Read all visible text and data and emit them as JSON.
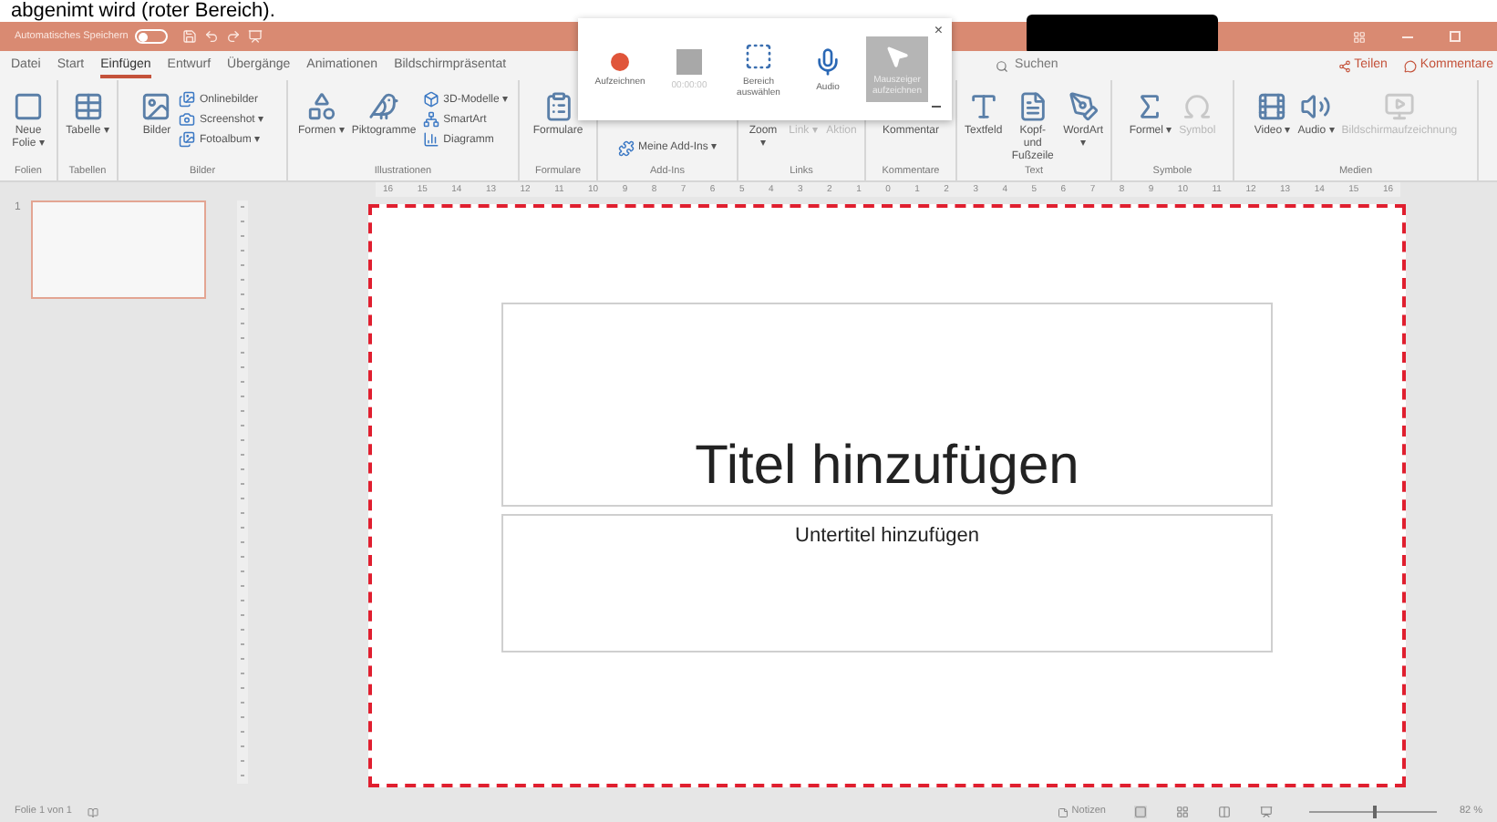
{
  "caption": "abgenimt wird (roter Bereich).",
  "title_bar": {
    "autosave_label": "Automatisches Speichern",
    "autosave_on": false
  },
  "tabs": [
    {
      "label": "Datei",
      "selected": false
    },
    {
      "label": "Start",
      "selected": false
    },
    {
      "label": "Einfügen",
      "selected": true
    },
    {
      "label": "Entwurf",
      "selected": false
    },
    {
      "label": "Übergänge",
      "selected": false
    },
    {
      "label": "Animationen",
      "selected": false
    },
    {
      "label": "Bildschirmpräsentat",
      "selected": false
    }
  ],
  "search": {
    "placeholder": "Suchen"
  },
  "share_button": "Teilen",
  "comments_button": "Kommentare",
  "ribbon_groups": [
    {
      "label": "Folien",
      "items": [
        {
          "kind": "large",
          "label": "Neue Folie ▾",
          "disabled": false
        }
      ]
    },
    {
      "label": "Tabellen",
      "items": [
        {
          "kind": "large",
          "label": "Tabelle ▾",
          "disabled": false
        }
      ]
    },
    {
      "label": "Bilder",
      "items": [
        {
          "kind": "large",
          "label": "Bilder",
          "disabled": false
        },
        {
          "kind": "small",
          "label": "Onlinebilder",
          "disabled": false
        },
        {
          "kind": "small",
          "label": "Screenshot ▾",
          "disabled": false
        },
        {
          "kind": "small",
          "label": "Fotoalbum ▾",
          "disabled": false
        }
      ]
    },
    {
      "label": "Illustrationen",
      "items": [
        {
          "kind": "large",
          "label": "Formen ▾",
          "disabled": false
        },
        {
          "kind": "large",
          "label": "Piktogramme",
          "disabled": false
        },
        {
          "kind": "small",
          "label": "3D-Modelle ▾",
          "disabled": false
        },
        {
          "kind": "small",
          "label": "SmartArt",
          "disabled": false
        },
        {
          "kind": "small",
          "label": "Diagramm",
          "disabled": false
        }
      ]
    },
    {
      "label": "Formulare",
      "items": [
        {
          "kind": "large",
          "label": "Formulare",
          "disabled": false
        }
      ]
    },
    {
      "label": "Add-Ins",
      "items": [
        {
          "kind": "small",
          "label": "Meine Add-Ins ▾",
          "disabled": false
        }
      ]
    },
    {
      "label": "Links",
      "items": [
        {
          "kind": "large",
          "label": "Zoom ▾",
          "disabled": false
        },
        {
          "kind": "large",
          "label": "Link ▾",
          "disabled": true
        },
        {
          "kind": "large",
          "label": "Aktion",
          "disabled": true
        }
      ]
    },
    {
      "label": "Kommentare",
      "items": [
        {
          "kind": "large",
          "label": "Kommentar",
          "disabled": false
        }
      ]
    },
    {
      "label": "Text",
      "items": [
        {
          "kind": "large",
          "label": "Textfeld",
          "disabled": false
        },
        {
          "kind": "large",
          "label": "Kopf- und Fußzeile",
          "disabled": false
        },
        {
          "kind": "large",
          "label": "WordArt ▾",
          "disabled": false
        }
      ]
    },
    {
      "label": "Symbole",
      "items": [
        {
          "kind": "large",
          "label": "Formel ▾",
          "disabled": false
        },
        {
          "kind": "large",
          "label": "Symbol",
          "disabled": true
        }
      ]
    },
    {
      "label": "Medien",
      "items": [
        {
          "kind": "large",
          "label": "Video ▾",
          "disabled": false
        },
        {
          "kind": "large",
          "label": "Audio ▾",
          "disabled": false
        },
        {
          "kind": "large",
          "label": "Bildschirmaufzeichnung",
          "disabled": true
        }
      ]
    }
  ],
  "recorder": {
    "close": "×",
    "buttons": [
      {
        "kind": "record",
        "label": "Aufzeichnen",
        "selected": false,
        "disabled": false
      },
      {
        "kind": "stop",
        "label": "00:00:00",
        "selected": false,
        "disabled": true
      },
      {
        "kind": "area",
        "label": "Bereich auswählen",
        "selected": false,
        "disabled": false
      },
      {
        "kind": "audio",
        "label": "Audio",
        "selected": false,
        "disabled": false
      },
      {
        "kind": "pointer",
        "label": "Mauszeiger aufzeichnen",
        "selected": true,
        "disabled": false
      }
    ]
  },
  "ruler_labels": [
    "16",
    "15",
    "14",
    "13",
    "12",
    "11",
    "10",
    "9",
    "8",
    "7",
    "6",
    "5",
    "4",
    "3",
    "2",
    "1",
    "0",
    "1",
    "2",
    "3",
    "4",
    "5",
    "6",
    "7",
    "8",
    "9",
    "10",
    "11",
    "12",
    "13",
    "14",
    "15",
    "16"
  ],
  "thumbnails": [
    {
      "number": "1",
      "selected": true
    }
  ],
  "slide": {
    "title_placeholder": "Titel hinzufügen",
    "subtitle_placeholder": "Untertitel hinzufügen",
    "highlighted": true
  },
  "status_bar": {
    "slide_info": "Folie 1 von 1",
    "notes_button": "Notizen",
    "zoom": {
      "level": 0.5,
      "text": "82 %"
    }
  }
}
